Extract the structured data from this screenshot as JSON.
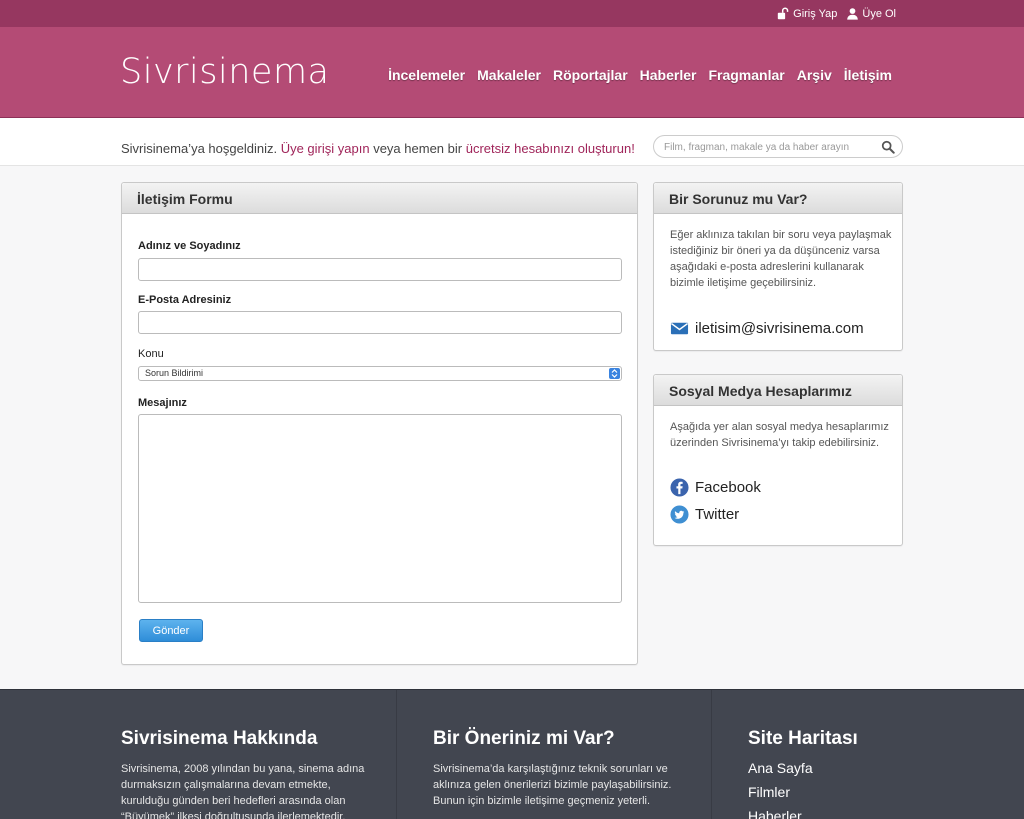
{
  "topbar": {
    "login_label": "Giriş Yap",
    "register_label": "Üye Ol"
  },
  "header": {
    "logo": "Sivrisinema",
    "nav": [
      "İncelemeler",
      "Makaleler",
      "Röportajlar",
      "Haberler",
      "Fragmanlar",
      "Arşiv",
      "İletişim"
    ]
  },
  "welcome": {
    "prefix": "Sivrisinema’ya hoşgeldiniz.",
    "login_link": "Üye girişi yapın",
    "middle": "veya hemen bir",
    "signup_link": "ücretsiz hesabınızı oluşturun!"
  },
  "search": {
    "placeholder": "Film, fragman, makale ya da haber arayın"
  },
  "form": {
    "title": "İletişim Formu",
    "name_label": "Adınız ve Soyadınız",
    "name_value": "",
    "email_label": "E-Posta Adresiniz",
    "email_value": "",
    "subject_label": "Konu",
    "subject_selected": "Sorun Bildirimi",
    "message_label": "Mesajınız",
    "message_value": "",
    "submit_label": "Gönder"
  },
  "question_panel": {
    "title": "Bir Sorunuz mu Var?",
    "text": "Eğer aklınıza takılan bir soru veya paylaşmak istediğiniz bir öneri ya da düşünceniz varsa aşağıdaki e-posta adreslerini kullanarak bizimle iletişime geçebilirsiniz.",
    "email": "iletisim@sivrisinema.com"
  },
  "social_panel": {
    "title": "Sosyal Medya Hesaplarımız",
    "text": "Aşağıda yer alan sosyal medya hesaplarımız üzerinden Sivrisinema’yı takip edebilirsiniz.",
    "facebook": "Facebook",
    "twitter": "Twitter"
  },
  "footer": {
    "about_title": "Sivrisinema Hakkında",
    "about_text": "Sivrisinema, 2008 yılından bu yana, sinema adına durmaksızın çalışmalarına devam etmekte, kurulduğu günden beri hedefleri arasında olan “Büyümek” ilkesi doğrultusunda ilerlemektedir.",
    "suggest_title": "Bir Öneriniz mi Var?",
    "suggest_text": "Sivrisinema’da karşılaştığınız teknik sorunları ve aklınıza gelen önerilerizi bizimle paylaşabilirsiniz. Bunun için bizimle iletişime geçmeniz yeterli.",
    "sitemap_title": "Site Haritası",
    "sitemap_items": [
      "Ana Sayfa",
      "Filmler",
      "Haberler"
    ]
  },
  "colors": {
    "topbar": "#963760",
    "header": "#b44b75",
    "accent_link": "#a0255a",
    "footer": "#424650",
    "button": "#2f8dd8"
  },
  "icons": {
    "login": "unlock-icon",
    "register": "user-icon",
    "search": "search-icon",
    "email": "envelope-icon",
    "facebook": "facebook-icon",
    "twitter": "twitter-icon"
  }
}
